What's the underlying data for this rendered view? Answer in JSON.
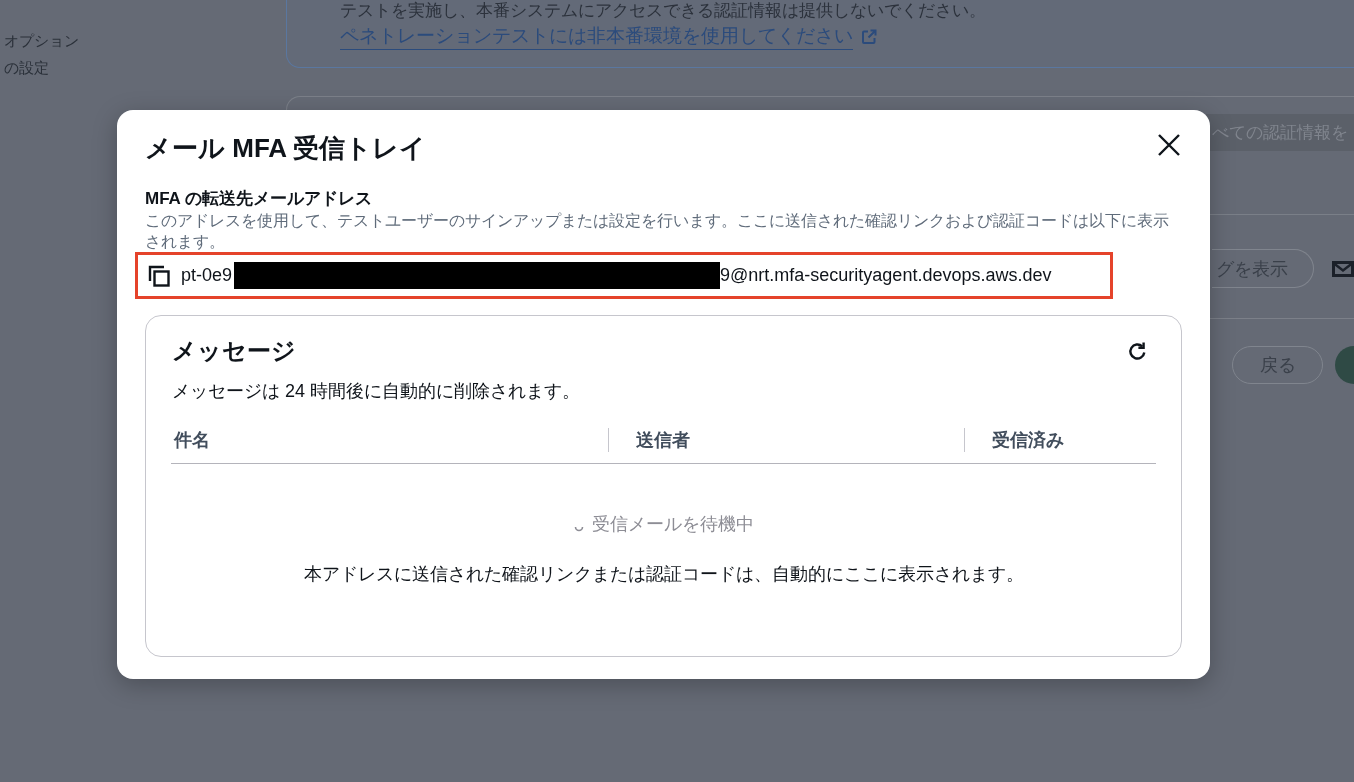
{
  "background": {
    "sidebar_item": "オプションの設定",
    "notice": {
      "text": "テストを実施し、本番システムにアクセスできる認証情報は提供しないでください。",
      "link": "ペネトレーションテストには非本番環境を使用してください"
    },
    "banner_text": "べての認証情報を",
    "view_button": "グを表示",
    "back_button": "戻る"
  },
  "modal": {
    "title": "メール MFA 受信トレイ",
    "address": {
      "label": "MFA の転送先メールアドレス",
      "description": "このアドレスを使用して、テストユーザーのサインアップまたは設定を行います。ここに送信された確認リンクおよび認証コードは以下に表示されます。",
      "value_start": "pt-0e9",
      "value_end": "9@nrt.mfa-securityagent.devops.aws.dev",
      "highlighted": true
    },
    "messages": {
      "title": "メッセージ",
      "subtitle": "メッセージは 24 時間後に自動的に削除されます。",
      "columns": [
        "件名",
        "送信者",
        "受信済み"
      ],
      "empty_state": {
        "status": "受信メールを待機中",
        "hint": "本アドレスに送信された確認リンクまたは認証コードは、自動的にここに表示されます。"
      }
    }
  }
}
